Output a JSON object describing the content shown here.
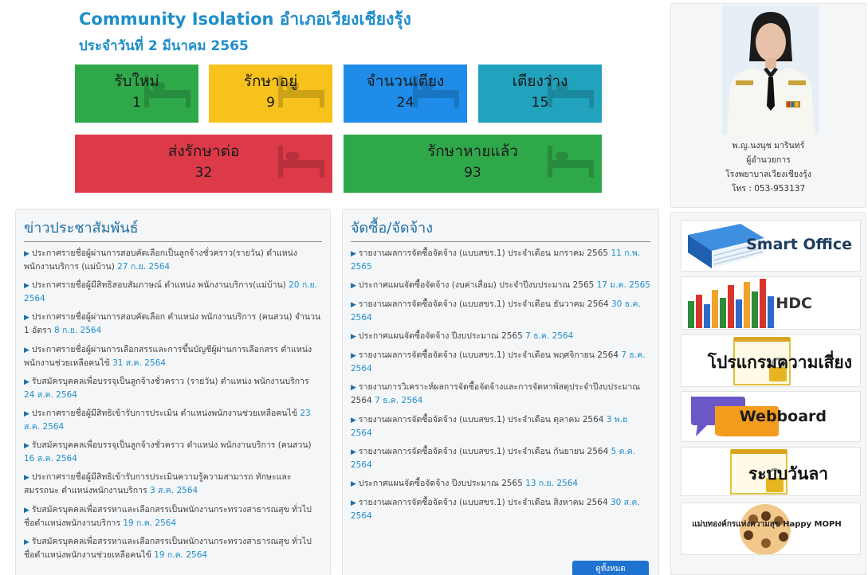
{
  "header": {
    "title": "Community Isolation อำเภอเวียงเชียงรุ้ง",
    "subtitle": "ประจำวันที่ 2 มีนาคม 2565"
  },
  "stats": [
    {
      "label": "รับใหม่",
      "value": "1",
      "color": "#2fa84a"
    },
    {
      "label": "รักษาอยู่",
      "value": "9",
      "color": "#f7c21c"
    },
    {
      "label": "จำนวนเตียง",
      "value": "24",
      "color": "#1e8ce8"
    },
    {
      "label": "เตียงว่าง",
      "value": "15",
      "color": "#21a3bd"
    },
    {
      "label": "ส่งรักษาต่อ",
      "value": "32",
      "color": "#dc3a48"
    },
    {
      "label": "รักษาหายแล้ว",
      "value": "93",
      "color": "#2fa84a"
    }
  ],
  "news": {
    "heading": "ข่าวประชาสัมพันธ์",
    "items": [
      {
        "text": "ประกาศรายชื่อผู้ผ่านการสอบคัดเลือกเป็นลูกจ้างชั่วคราว(รายวัน) ตำแหน่ง พนักงานบริการ (แม่บ้าน)",
        "date": "27 ก.ย. 2564"
      },
      {
        "text": "ประกาศรายชื่อผู้มีสิทธิสอบสัมภาษณ์ ตำแหน่ง พนักงานบริการ(แม่บ้าน)",
        "date": "20 ก.ย. 2564"
      },
      {
        "text": "ประกาศรายชื่อผู้ผ่านการสอบคัดเลือก ตำแหน่ง พนักงานบริการ (คนสวน) จำนวน 1 อัตรา",
        "date": "8 ก.ย. 2564"
      },
      {
        "text": "ประกาศรายชื่อผู้ผ่านการเลือกสรรและการขึ้นบัญชีผู้ผ่านการเลือกสรร ตำแหน่ง พนักงานช่วยเหลือคนไข้",
        "date": "31 ส.ค. 2564"
      },
      {
        "text": "รับสมัครบุคคลเพื่อบรรจุเป็นลูกจ้างชั่วคราว (รายวัน) ตำแหน่ง พนักงานบริการ",
        "date": "24 ส.ค. 2564"
      },
      {
        "text": "ประกาศรายชื่อผู้มีสิทธิเข้ารับการประเมิน ตำแหน่งพนักงานช่วยเหลือคนไข้",
        "date": "23 ส.ค. 2564"
      },
      {
        "text": "รับสมัครบุคคลเพื่อบรรจุเป็นลูกจ้างชั่วคราว ตำแหน่ง พนักงานบริการ (คนสวน)",
        "date": "16 ส.ค. 2564"
      },
      {
        "text": "ประกาศรายชื่อผู้มีสิทธิเข้ารับการประเมินความรู้ความสามารถ ทักษะและสมรรถนะ ตำแหน่งพนักงานบริการ",
        "date": "3 ส.ค. 2564"
      },
      {
        "text": "รับสมัครบุคคลเพื่อสรรหาและเลือกสรรเป็นพนักงานกระทรวงสาธารณสุข ทั่วไป ชื่อตำแหน่งพนักงานบริการ",
        "date": "19 ก.ค. 2564"
      },
      {
        "text": "รับสมัครบุคคลเพื่อสรรหาและเลือกสรรเป็นพนักงานกระทรวงสาธารณสุข ทั่วไป ชื่อตำแหน่งพนักงานช่วยเหลือคนไข้",
        "date": "19 ก.ค. 2564"
      }
    ]
  },
  "procurement": {
    "heading": "จัดซื้อ/จัดจ้าง",
    "items": [
      {
        "text": "รายงานผลการจัดซื้อจัดจ้าง (แบบสขร.1) ประจำเดือน มกราคม 2565",
        "date": "11 ก.พ. 2565"
      },
      {
        "text": "ประกาศแผนจัดซื้อจัดจ้าง (งบค่าเสื่อม) ประจำปีงบประมาณ 2565",
        "date": "17 ม.ค. 2565"
      },
      {
        "text": "รายงานผลการจัดซื้อจัดจ้าง (แบบสขร.1) ประจำเดือน ธันวาคม 2564",
        "date": "30 ธ.ค. 2564"
      },
      {
        "text": "ประกาศแผนจัดซื้อจัดจ้าง ปีงบประมาณ 2565",
        "date": "7 ธ.ค. 2564"
      },
      {
        "text": "รายงานผลการจัดซื้อจัดจ้าง (แบบสขร.1) ประจำเดือน พฤศจิกายน 2564",
        "date": "7 ธ.ค. 2564"
      },
      {
        "text": "รายงานการวิเคราะห์ผลการจัดซื้อจัดจ้างและการจัดหาพัสดุประจำปีงบประมาณ 2564",
        "date": "7 ธ.ค. 2564"
      },
      {
        "text": "รายงานผลการจัดซื้อจัดจ้าง (แบบสขร.1) ประจำเดือน ตุลาคม 2564",
        "date": "3 พ.ย 2564"
      },
      {
        "text": "รายงานผลการจัดซื้อจัดจ้าง (แบบสขร.1) ประจำเดือน กันยายน 2564",
        "date": "5 ต.ค. 2564"
      },
      {
        "text": "ประกาศแผนจัดซื้อจัดจ้าง ปีงบประมาณ 2565",
        "date": "13 ก.ย. 2564"
      },
      {
        "text": "รายงานผลการจัดซื้อจัดจ้าง (แบบสขร.1) ประจำเดือน สิงหาคม 2564",
        "date": "30 ส.ค. 2564"
      }
    ],
    "view_all": "ดูทั้งหมด"
  },
  "profile": {
    "name": "พ.ญ.นงนุช มารินทร์",
    "position": "ผู้อำนวยการ",
    "hospital": "โรงพยาบาลเวียงเชียงรุ้ง",
    "phone": "โทร : 053-953137"
  },
  "banners": [
    {
      "label": "Smart Office",
      "icon": "book-icon"
    },
    {
      "label": "HDC",
      "icon": "bar-chart-icon"
    },
    {
      "label": "โปรแกรมความเสี่ยง",
      "icon": "notepad-lock-icon"
    },
    {
      "label": "Webboard",
      "icon": "chat-bubbles-icon"
    },
    {
      "label": "ระบบวันลา",
      "icon": "notepad-lock-icon"
    },
    {
      "label": "แม่บทองค์กรแห่งความสุข Happy MOPH",
      "icon": "people-circle-icon"
    }
  ]
}
